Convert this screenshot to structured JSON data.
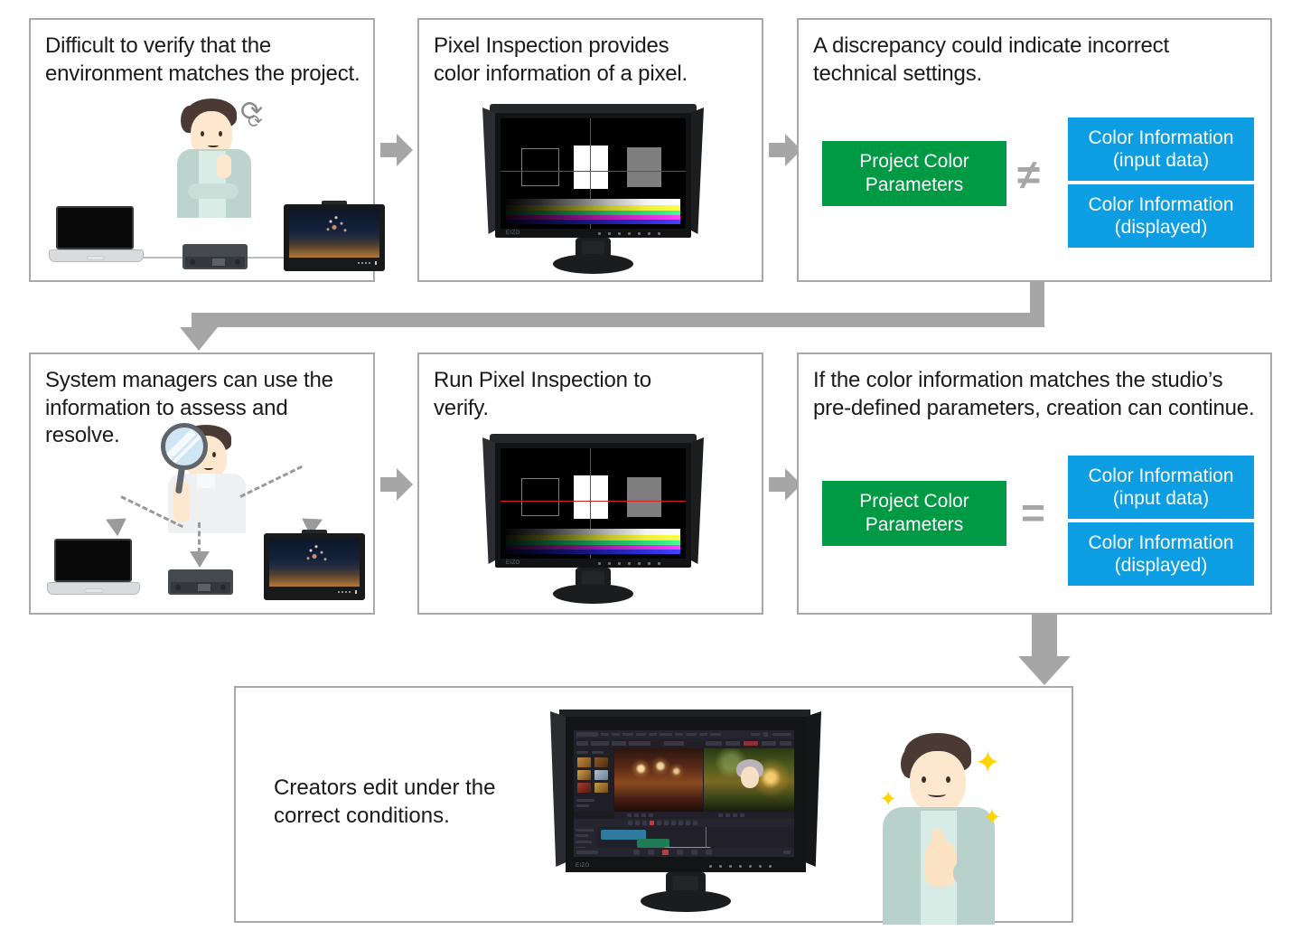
{
  "diagram": {
    "title": "Pixel Inspection workflow",
    "colors": {
      "panel_border": "#a8a8a8",
      "arrow_gray": "#a6a6a6",
      "green": "#009944",
      "blue": "#0c9de3",
      "text": "#1a1a1a",
      "sparkle_yellow": "#ffd400"
    }
  },
  "panels": [
    {
      "id": "panel-problem",
      "caption": "Difficult to verify that the\nenvironment matches the project.",
      "illustration": "laptop-device-field-monitor-with-confused-person"
    },
    {
      "id": "panel-pixel-inspection",
      "caption": "Pixel Inspection provides\ncolor information of a pixel.",
      "illustration": "coloredge-monitor-pixel-inspection"
    },
    {
      "id": "panel-discrepancy",
      "caption": "A discrepancy could indicate incorrect\ntechnical settings.",
      "compare": {
        "left_label": "Project Color\nParameters",
        "symbol": "≠",
        "symbol_name": "not-equal-sign",
        "right": [
          {
            "line1": "Color Information",
            "line2": "(input data)"
          },
          {
            "line1": "Color Information",
            "line2": "(displayed)"
          }
        ]
      }
    },
    {
      "id": "panel-system-managers",
      "caption": "System managers can use the\ninformation to assess and resolve.",
      "illustration": "person-with-magnifier-pointing-to-laptop-device-monitor"
    },
    {
      "id": "panel-run-inspection",
      "caption": "Run Pixel Inspection to\nverify.",
      "illustration": "coloredge-monitor-pixel-inspection"
    },
    {
      "id": "panel-matches",
      "caption": "If the color information matches the studio’s\npre-defined parameters, creation can continue.",
      "compare": {
        "left_label": "Project Color\nParameters",
        "symbol": "=",
        "symbol_name": "equals-sign",
        "right": [
          {
            "line1": "Color Information",
            "line2": "(input data)"
          },
          {
            "line1": "Color Information",
            "line2": "(displayed)"
          }
        ]
      }
    },
    {
      "id": "panel-creators-edit",
      "caption": "Creators edit under the\ncorrect conditions.",
      "illustration": "coloredge-monitor-video-editing-with-happy-creator"
    }
  ],
  "connectors": [
    {
      "name": "arrow-panel1-to-panel2",
      "direction": "right"
    },
    {
      "name": "arrow-panel2-to-panel3",
      "direction": "right"
    },
    {
      "name": "arrow-row1-to-row2",
      "direction": "down-left-wrap"
    },
    {
      "name": "arrow-panel4-to-panel5",
      "direction": "right"
    },
    {
      "name": "arrow-panel5-to-panel6",
      "direction": "right"
    },
    {
      "name": "arrow-row2-to-bottom",
      "direction": "down"
    }
  ]
}
